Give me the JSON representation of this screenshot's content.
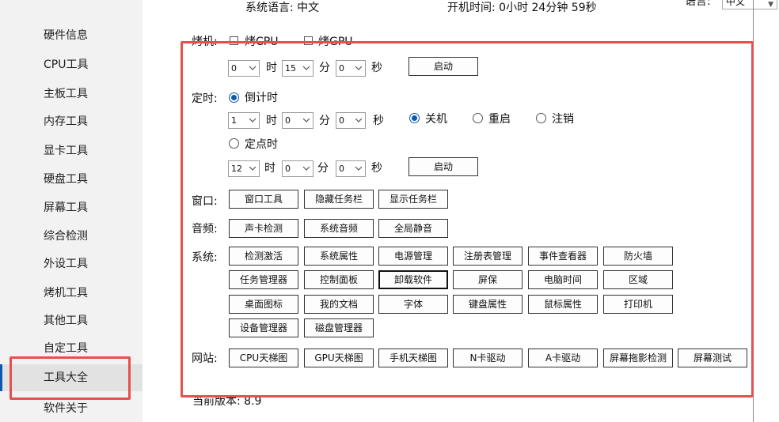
{
  "sidebar": {
    "items": [
      {
        "label": "硬件信息"
      },
      {
        "label": "CPU工具"
      },
      {
        "label": "主板工具"
      },
      {
        "label": "内存工具"
      },
      {
        "label": "显卡工具"
      },
      {
        "label": "硬盘工具"
      },
      {
        "label": "屏幕工具"
      },
      {
        "label": "综合检测"
      },
      {
        "label": "外设工具"
      },
      {
        "label": "烤机工具"
      },
      {
        "label": "其他工具"
      },
      {
        "label": "自定工具"
      },
      {
        "label": "工具大全"
      },
      {
        "label": "软件关于"
      }
    ],
    "active_index": 12
  },
  "header": {
    "system_language": "系统语言: 中文",
    "uptime": "开机时间: 0小时 24分钟 59秒",
    "language_label": "语言:",
    "language_value": "中文"
  },
  "burn": {
    "label": "烤机:",
    "cpu_label": "烤CPU",
    "gpu_label": "烤GPU",
    "hours": "0",
    "hour_unit": "时",
    "minutes": "15",
    "minute_unit": "分",
    "seconds": "0",
    "second_unit": "秒",
    "start_label": "启动"
  },
  "timer": {
    "label": "定时:",
    "countdown_label": "倒计时",
    "cd_hours": "1",
    "cd_minutes": "0",
    "cd_seconds": "0",
    "hour_unit": "时",
    "minute_unit": "分",
    "second_unit": "秒",
    "shutdown_label": "关机",
    "restart_label": "重启",
    "logoff_label": "注销",
    "fixed_time_label": "定点时",
    "ft_hours": "12",
    "ft_minutes": "0",
    "ft_seconds": "0",
    "start_label": "启动"
  },
  "window": {
    "label": "窗口:",
    "buttons": [
      "窗口工具",
      "隐藏任务栏",
      "显示任务栏"
    ]
  },
  "audio": {
    "label": "音频:",
    "buttons": [
      "声卡检测",
      "系统音频",
      "全局静音"
    ]
  },
  "system": {
    "label": "系统:",
    "buttons": [
      "检测激活",
      "系统属性",
      "电源管理",
      "注册表管理",
      "事件查看器",
      "防火墙",
      "任务管理器",
      "控制面板",
      "卸载软件",
      "屏保",
      "电脑时间",
      "区域",
      "桌面图标",
      "我的文档",
      "字体",
      "键盘属性",
      "鼠标属性",
      "打印机",
      "设备管理器",
      "磁盘管理器"
    ]
  },
  "website": {
    "label": "网站:",
    "buttons": [
      "CPU天梯图",
      "GPU天梯图",
      "手机天梯图",
      "N卡驱动",
      "A卡驱动",
      "屏幕拖影检测",
      "屏幕测试"
    ]
  },
  "footer": {
    "version": "当前版本: 8.9"
  },
  "colors": {
    "annotation_red": "#e5504f",
    "accent_blue": "#0a5ab4"
  }
}
